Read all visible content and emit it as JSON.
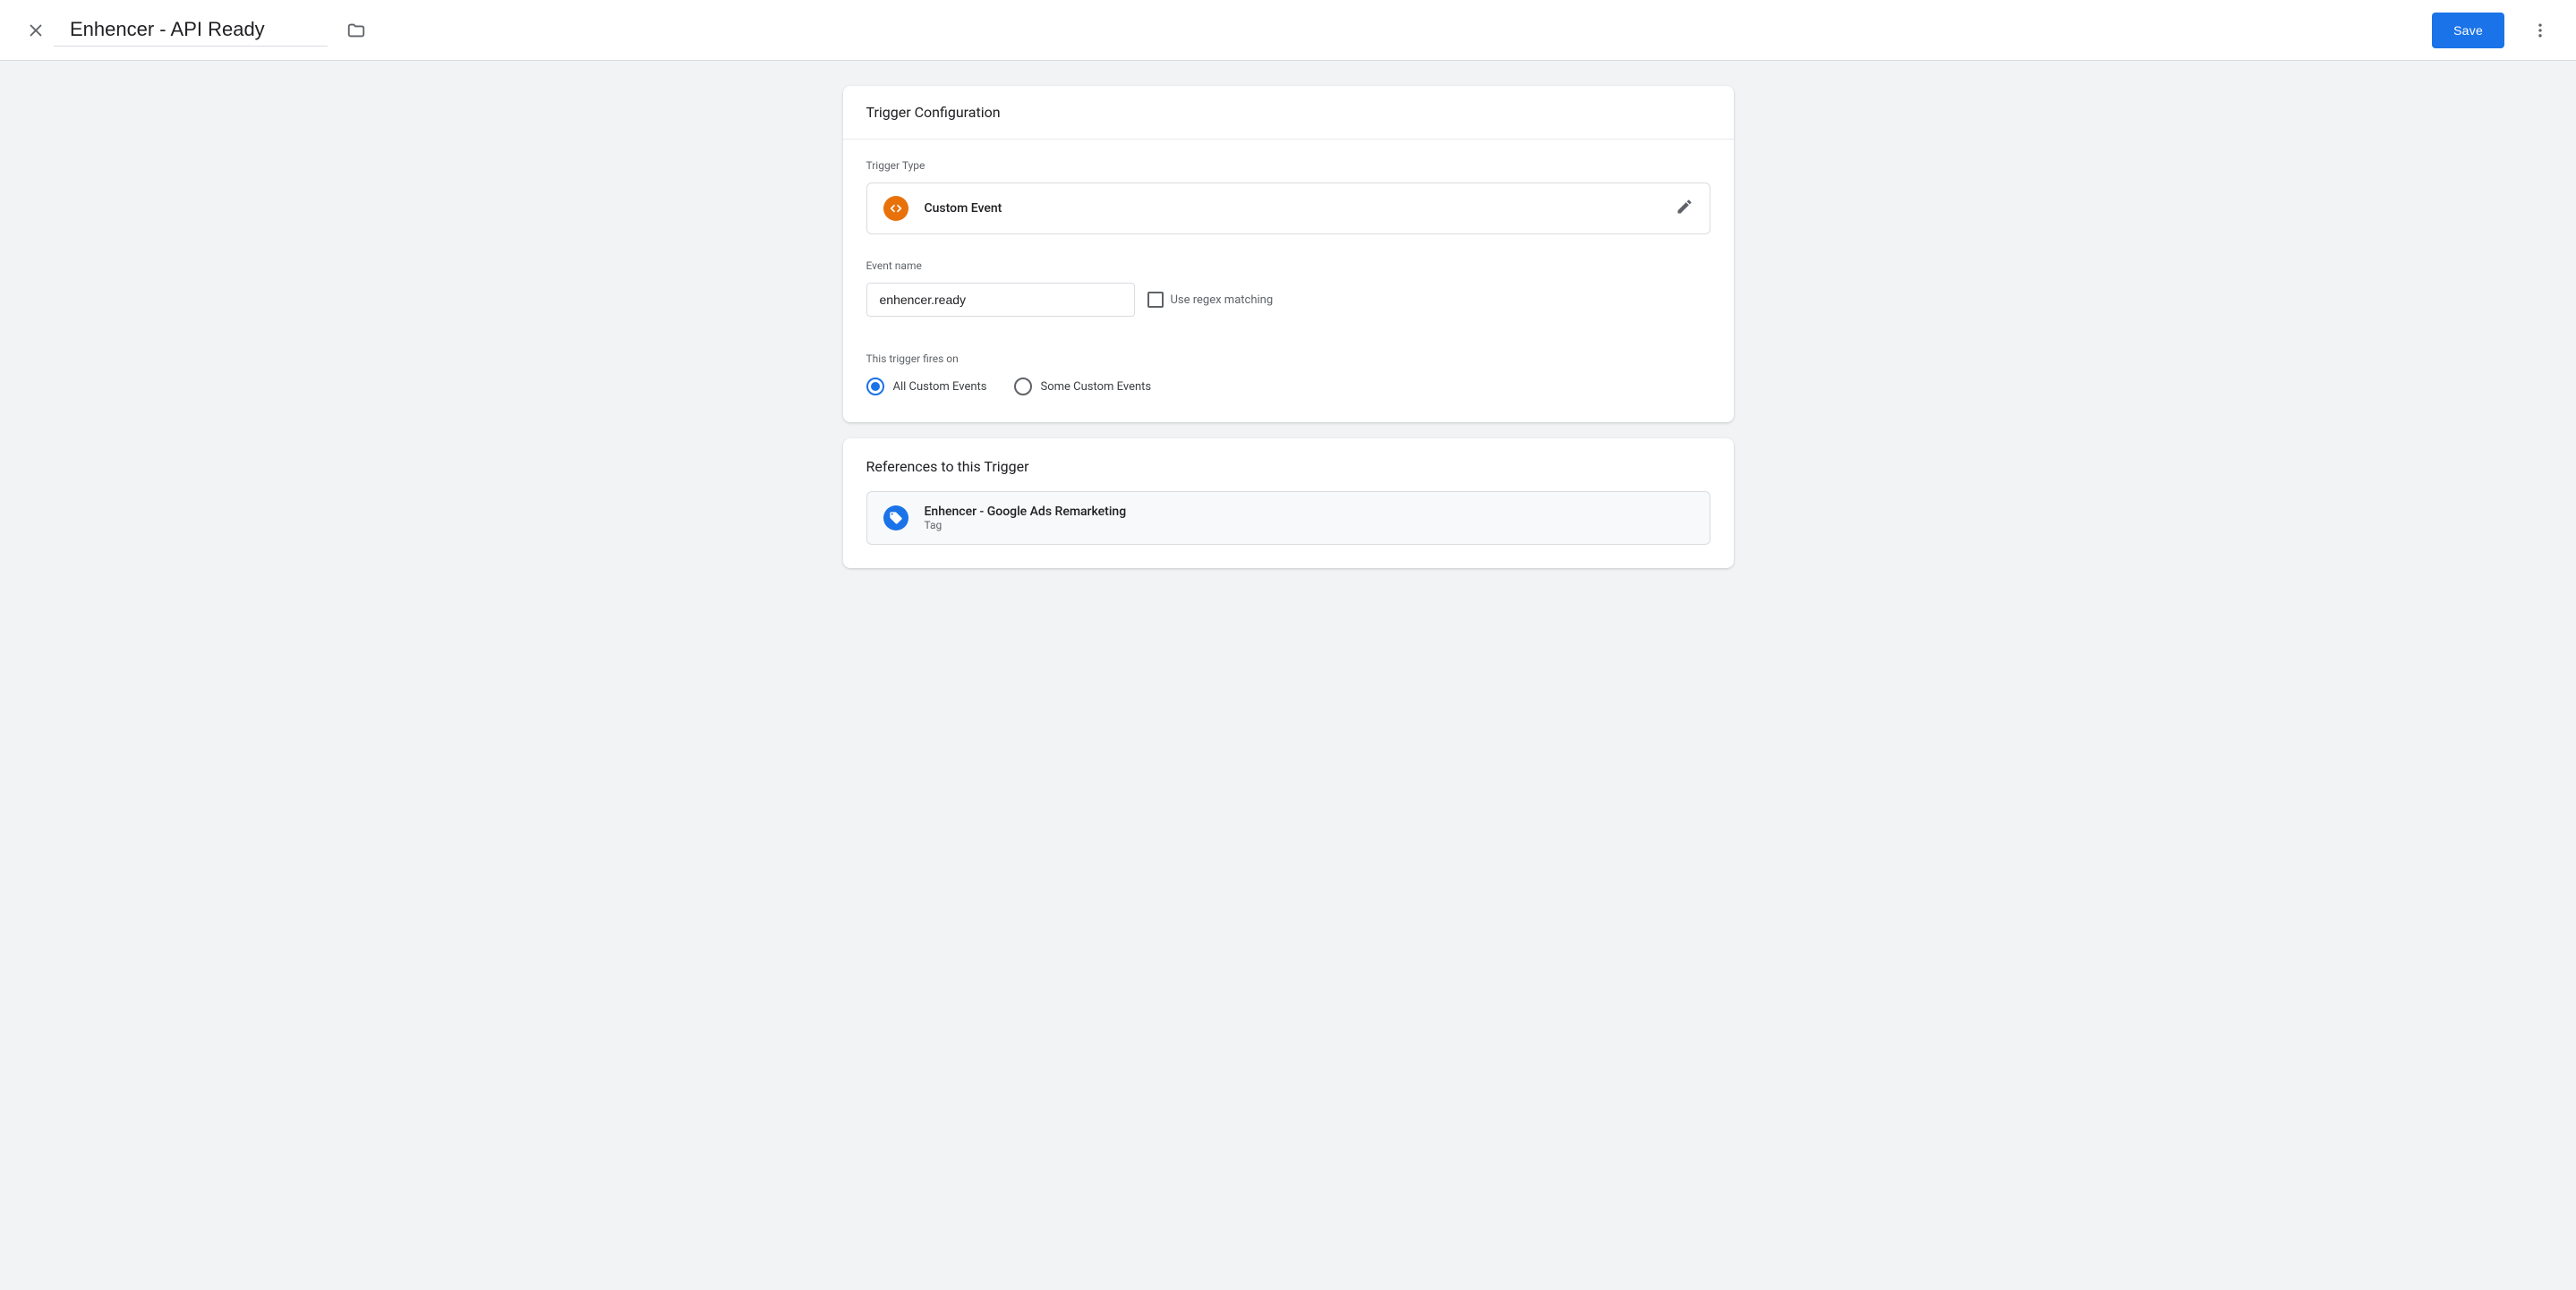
{
  "header": {
    "title": "Enhencer - API Ready",
    "save_label": "Save"
  },
  "config": {
    "section_title": "Trigger Configuration",
    "trigger_type_label": "Trigger Type",
    "trigger_type_value": "Custom Event",
    "event_name_label": "Event name",
    "event_name_value": "enhencer.ready",
    "regex_label": "Use regex matching",
    "fires_on_label": "This trigger fires on",
    "fires_on_options": {
      "all": "All Custom Events",
      "some": "Some Custom Events"
    }
  },
  "references": {
    "section_title": "References to this Trigger",
    "items": [
      {
        "title": "Enhencer - Google Ads Remarketing",
        "subtitle": "Tag"
      }
    ]
  }
}
